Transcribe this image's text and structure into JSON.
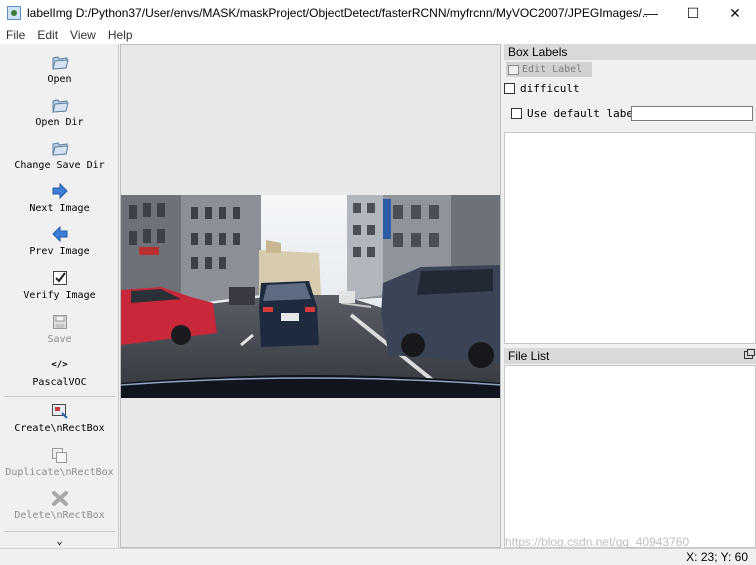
{
  "window": {
    "title": "labelImg D:/Python37/User/envs/MASK/maskProject/ObjectDetect/fasterRCNN/myfrcnn/MyVOC2007/JPEGImages/...",
    "minimize_glyph": "—",
    "maximize_glyph": "☐",
    "close_glyph": "✕"
  },
  "menu": [
    "File",
    "Edit",
    "View",
    "Help"
  ],
  "toolbar": {
    "open": "Open",
    "open_dir": "Open Dir",
    "change_save_dir": "Change Save Dir",
    "next_image": "Next Image",
    "prev_image": "Prev Image",
    "verify_image": "Verify Image",
    "save": "Save",
    "format": "PascalVOC",
    "format_glyph": "</>",
    "create_rectbox": "Create\\nRectBox",
    "duplicate_rectbox": "Duplicate\\nRectBox",
    "delete_rectbox": "Delete\\nRectBox",
    "more_glyph": "⌄"
  },
  "box_labels": {
    "title": "Box Labels",
    "edit_label": "Edit Label",
    "difficult": "difficult",
    "use_default_label": "Use default label",
    "default_label_value": ""
  },
  "file_list": {
    "title": "File List"
  },
  "status": {
    "coords": "X: 23; Y: 60"
  },
  "watermark": "https://blog.csdn.net/qq_40943760",
  "colors": {
    "accent_blue": "#3b7dd8",
    "panel_header": "#d9d9d9",
    "canvas_bg": "#e8e8e8"
  }
}
